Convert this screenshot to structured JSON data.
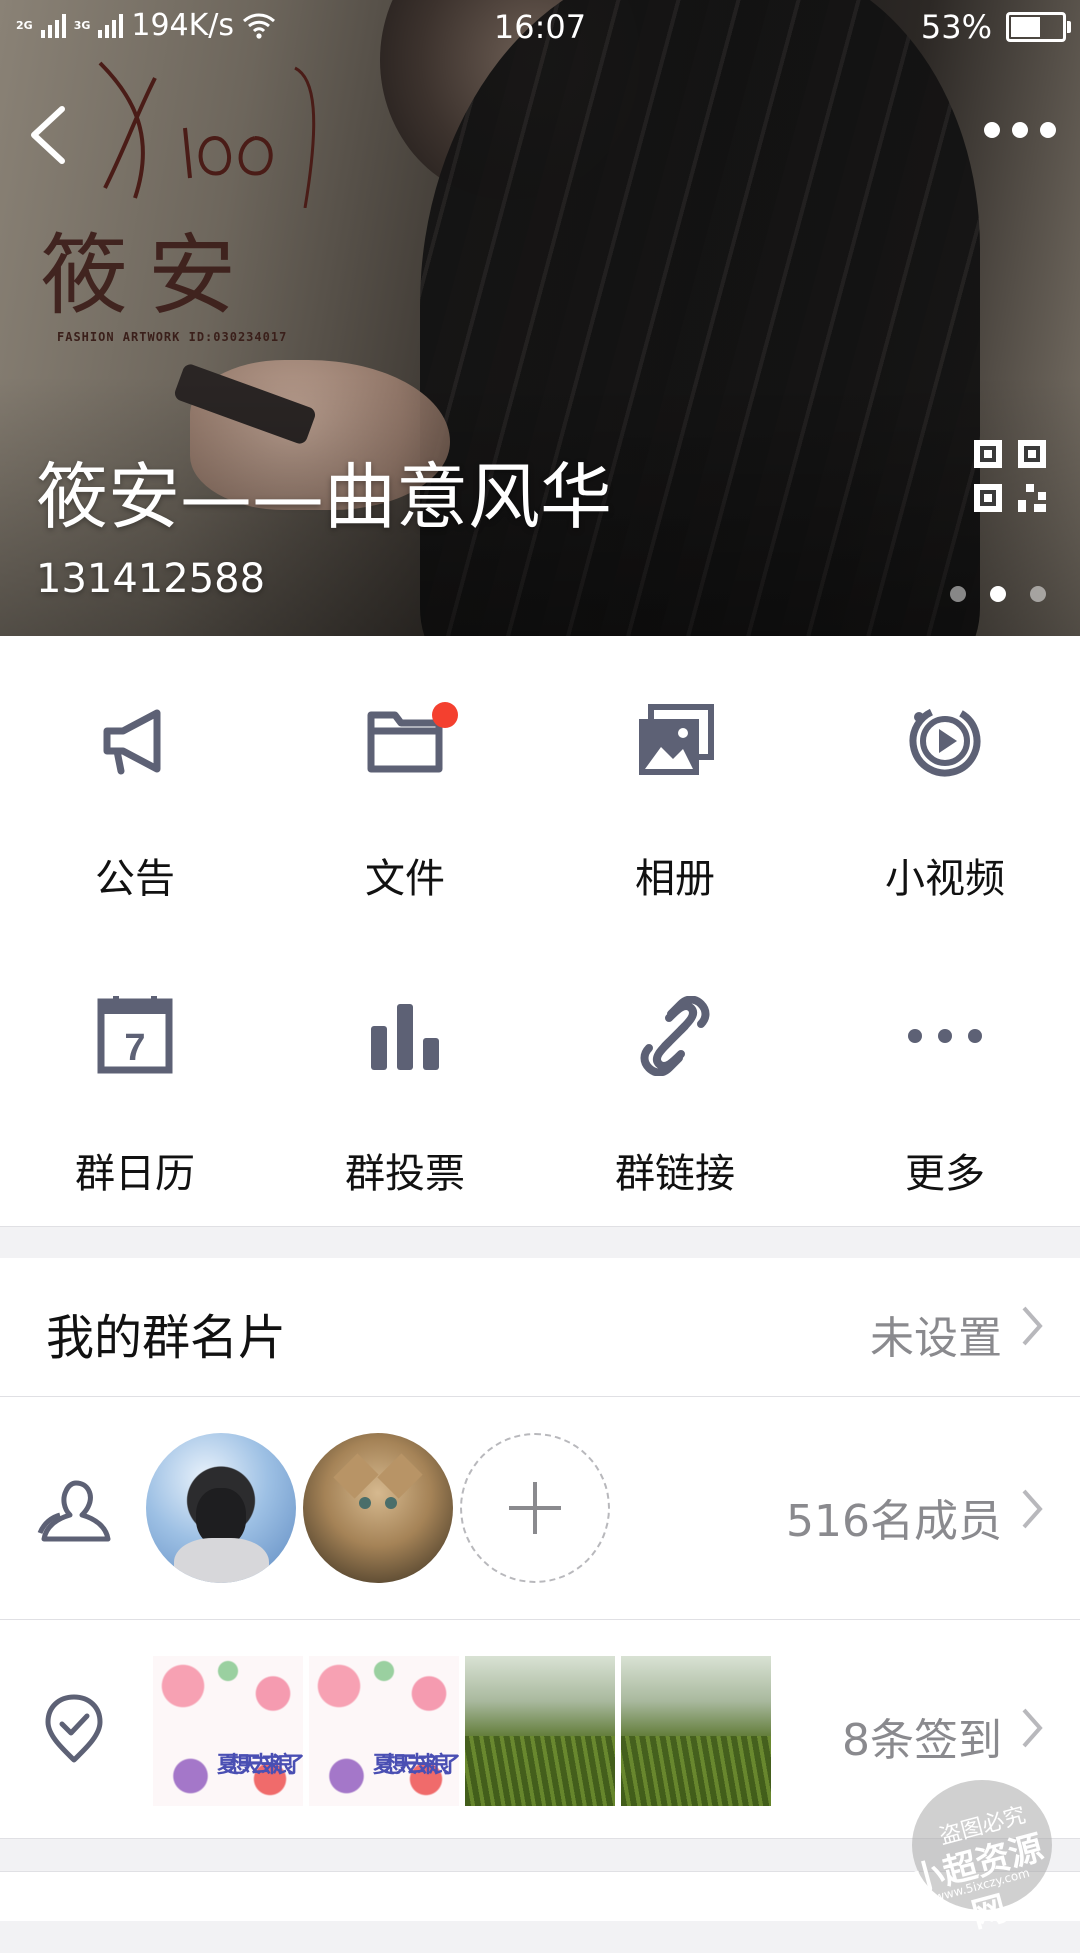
{
  "status_bar": {
    "net1": "2G",
    "net2": "3G",
    "speed": "194K/s",
    "time": "16:07",
    "battery_text": "53%",
    "battery_level": 0.53
  },
  "banner": {
    "group_name": "筱安——曲意风华",
    "group_id": "131412588",
    "artwork_calligraphy": "筱安",
    "artwork_latin": "Xiao",
    "artwork_caption": "FASHION ARTWORK ID:030234017",
    "page_indicator": {
      "count": 3,
      "active": 1
    }
  },
  "features": [
    {
      "label": "公告",
      "icon": "megaphone-icon"
    },
    {
      "label": "文件",
      "icon": "folder-icon",
      "badge": true
    },
    {
      "label": "相册",
      "icon": "album-icon"
    },
    {
      "label": "小视频",
      "icon": "video-icon"
    },
    {
      "label": "群日历",
      "icon": "calendar-icon",
      "day": "7"
    },
    {
      "label": "群投票",
      "icon": "bar-chart-icon"
    },
    {
      "label": "群链接",
      "icon": "link-icon"
    },
    {
      "label": "更多",
      "icon": "more-icon"
    }
  ],
  "card": {
    "title": "我的群名片",
    "value": "未设置"
  },
  "members": {
    "count_text": "516名成员"
  },
  "checkins": {
    "count_text": "8条签到",
    "thumb_text": [
      "夏天来了",
      "想去浪"
    ]
  },
  "watermark": {
    "line1": "盗图必究",
    "line2": "小超资源网",
    "line3": "www.5ixczy.com"
  },
  "colors": {
    "icon": "#5d6175",
    "badge": "#f4402f",
    "secondary_text": "#8a8a8e"
  }
}
